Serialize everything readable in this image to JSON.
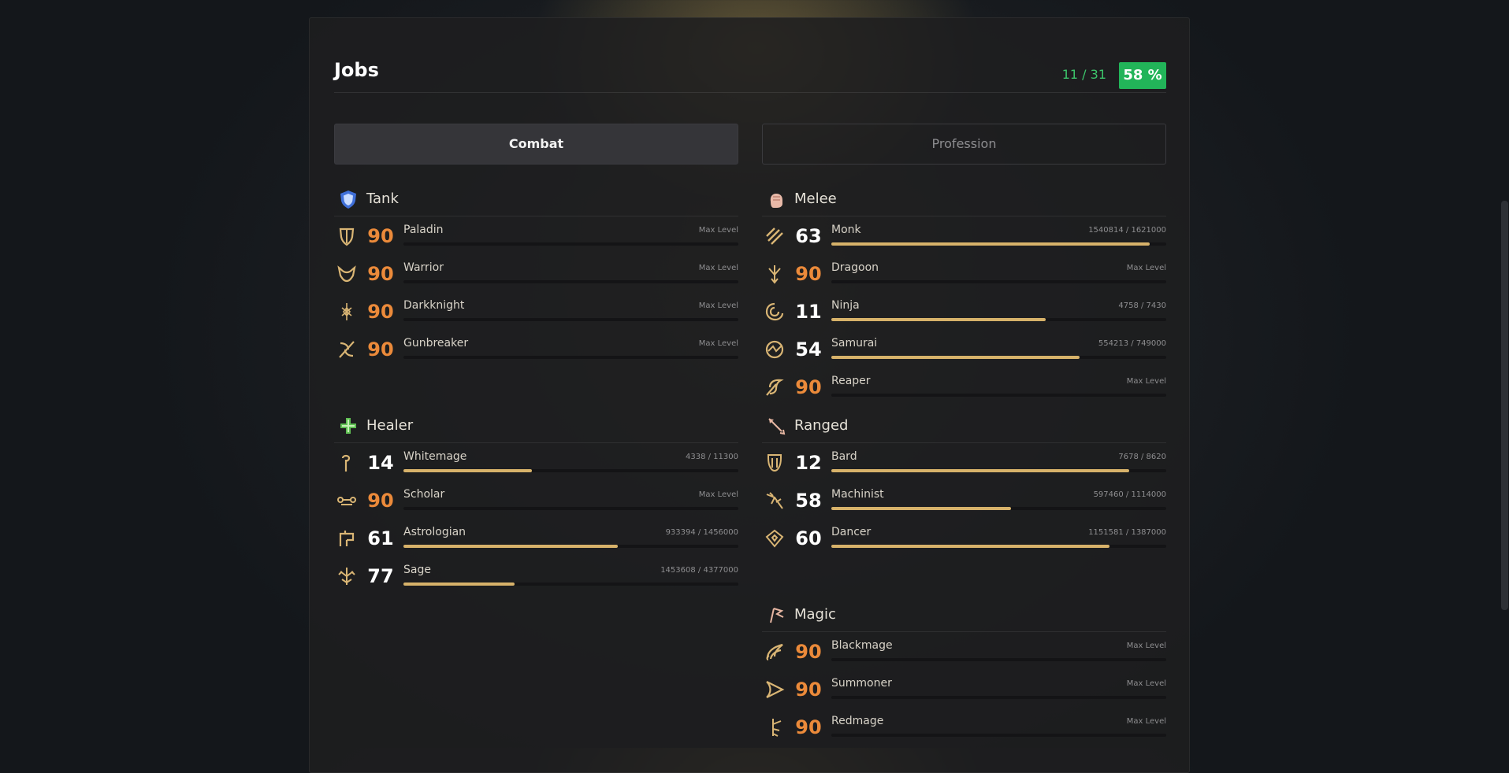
{
  "jobs_panel": {
    "title": "Jobs",
    "progress_count": "11 / 31",
    "progress_percent": "58 %"
  },
  "tabs": [
    {
      "label": "Combat",
      "active": true
    },
    {
      "label": "Profession",
      "active": false
    }
  ],
  "colors": {
    "max_level": "#eb8a3a",
    "progress_fill": "#d7b26a",
    "percent_badge": "#22b459",
    "count_text": "#3cc46a"
  },
  "groups": [
    {
      "id": "tank",
      "title": "Tank",
      "icon": "shield-icon",
      "jobs": [
        {
          "name": "Paladin",
          "level": "90",
          "exp": "Max Level",
          "progress": 0,
          "icon": "paladin-icon"
        },
        {
          "name": "Warrior",
          "level": "90",
          "exp": "Max Level",
          "progress": 0,
          "icon": "warrior-icon"
        },
        {
          "name": "Darkknight",
          "level": "90",
          "exp": "Max Level",
          "progress": 0,
          "icon": "darkknight-icon"
        },
        {
          "name": "Gunbreaker",
          "level": "90",
          "exp": "Max Level",
          "progress": 0,
          "icon": "gunbreaker-icon"
        }
      ]
    },
    {
      "id": "melee",
      "title": "Melee",
      "icon": "fist-icon",
      "jobs": [
        {
          "name": "Monk",
          "level": "63",
          "exp": "1540814 / 1621000",
          "progress": 0.95,
          "icon": "monk-icon"
        },
        {
          "name": "Dragoon",
          "level": "90",
          "exp": "Max Level",
          "progress": 0,
          "icon": "dragoon-icon"
        },
        {
          "name": "Ninja",
          "level": "11",
          "exp": "4758 / 7430",
          "progress": 0.64,
          "icon": "ninja-icon"
        },
        {
          "name": "Samurai",
          "level": "54",
          "exp": "554213 / 749000",
          "progress": 0.74,
          "icon": "samurai-icon"
        },
        {
          "name": "Reaper",
          "level": "90",
          "exp": "Max Level",
          "progress": 0,
          "icon": "reaper-icon"
        }
      ]
    },
    {
      "id": "healer",
      "title": "Healer",
      "icon": "green-cross-icon",
      "jobs": [
        {
          "name": "Whitemage",
          "level": "14",
          "exp": "4338 / 11300",
          "progress": 0.384,
          "icon": "whitemage-icon"
        },
        {
          "name": "Scholar",
          "level": "90",
          "exp": "Max Level",
          "progress": 0,
          "icon": "scholar-icon"
        },
        {
          "name": "Astrologian",
          "level": "61",
          "exp": "933394 / 1456000",
          "progress": 0.641,
          "icon": "astrologian-icon"
        },
        {
          "name": "Sage",
          "level": "77",
          "exp": "1453608 / 4377000",
          "progress": 0.332,
          "icon": "sage-icon"
        }
      ]
    },
    {
      "id": "ranged",
      "title": "Ranged",
      "icon": "bow-arrow-icon",
      "jobs": [
        {
          "name": "Bard",
          "level": "12",
          "exp": "7678 / 8620",
          "progress": 0.89,
          "icon": "bard-icon"
        },
        {
          "name": "Machinist",
          "level": "58",
          "exp": "597460 / 1114000",
          "progress": 0.536,
          "icon": "machinist-icon"
        },
        {
          "name": "Dancer",
          "level": "60",
          "exp": "1151581 / 1387000",
          "progress": 0.83,
          "icon": "dancer-icon"
        }
      ]
    },
    {
      "id": "magic",
      "title": "Magic",
      "icon": "staff-icon",
      "jobs": [
        {
          "name": "Blackmage",
          "level": "90",
          "exp": "Max Level",
          "progress": 0,
          "icon": "blackmage-icon"
        },
        {
          "name": "Summoner",
          "level": "90",
          "exp": "Max Level",
          "progress": 0,
          "icon": "summoner-icon"
        },
        {
          "name": "Redmage",
          "level": "90",
          "exp": "Max Level",
          "progress": 0,
          "icon": "redmage-icon"
        }
      ]
    }
  ]
}
